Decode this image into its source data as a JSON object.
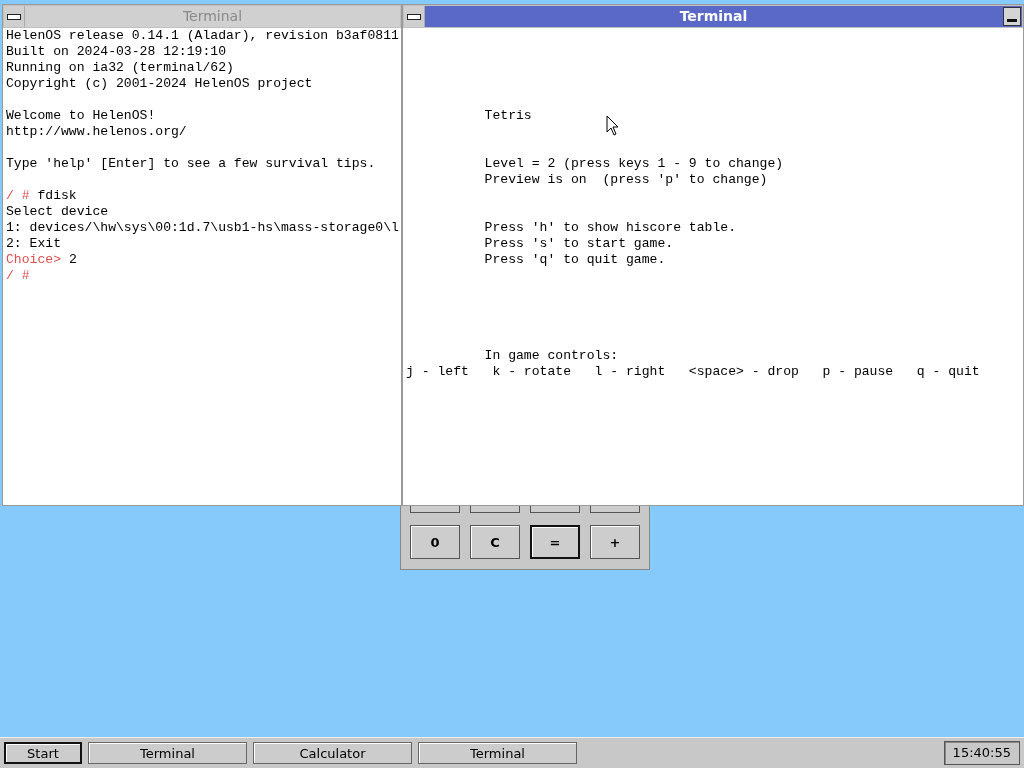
{
  "windows": [
    {
      "title": "Terminal",
      "active": false,
      "lines": [
        {
          "kind": "text",
          "segments": [
            {
              "text": "HelenOS release 0.14.1 (Aladar), revision b3af0811",
              "kind": "plain"
            }
          ]
        },
        {
          "kind": "text",
          "segments": [
            {
              "text": "Built on 2024-03-28 12:19:10",
              "kind": "plain"
            }
          ]
        },
        {
          "kind": "text",
          "segments": [
            {
              "text": "Running on ia32 (terminal/62)",
              "kind": "plain"
            }
          ]
        },
        {
          "kind": "text",
          "segments": [
            {
              "text": "Copyright (c) 2001-2024 HelenOS project",
              "kind": "plain"
            }
          ]
        },
        {
          "kind": "blank"
        },
        {
          "kind": "text",
          "segments": [
            {
              "text": "Welcome to HelenOS!",
              "kind": "plain"
            }
          ]
        },
        {
          "kind": "text",
          "segments": [
            {
              "text": "http://www.helenos.org/",
              "kind": "plain"
            }
          ]
        },
        {
          "kind": "blank"
        },
        {
          "kind": "text",
          "segments": [
            {
              "text": "Type 'help' [Enter] to see a few survival tips.",
              "kind": "plain"
            }
          ]
        },
        {
          "kind": "blank"
        },
        {
          "kind": "text",
          "segments": [
            {
              "text": "/ # ",
              "kind": "prompt"
            },
            {
              "text": "fdisk",
              "kind": "plain"
            }
          ]
        },
        {
          "kind": "text",
          "segments": [
            {
              "text": "Select device",
              "kind": "plain"
            }
          ]
        },
        {
          "kind": "text",
          "segments": [
            {
              "text": "1: devices/\\hw\\sys\\00:1d.7\\usb1-hs\\mass-storage0\\l",
              "kind": "plain"
            }
          ]
        },
        {
          "kind": "text",
          "segments": [
            {
              "text": "2: Exit",
              "kind": "plain"
            }
          ]
        },
        {
          "kind": "text",
          "segments": [
            {
              "text": "Choice> ",
              "kind": "prompt"
            },
            {
              "text": "2",
              "kind": "plain"
            }
          ]
        },
        {
          "kind": "text",
          "segments": [
            {
              "text": "/ #",
              "kind": "prompt"
            }
          ]
        }
      ]
    },
    {
      "title": "Terminal",
      "active": true,
      "lines": [
        {
          "kind": "blank"
        },
        {
          "kind": "blank"
        },
        {
          "kind": "blank"
        },
        {
          "kind": "blank"
        },
        {
          "kind": "blank"
        },
        {
          "kind": "text",
          "segments": [
            {
              "text": "          Tetris",
              "kind": "plain"
            }
          ]
        },
        {
          "kind": "blank"
        },
        {
          "kind": "blank"
        },
        {
          "kind": "text",
          "segments": [
            {
              "text": "          Level = 2 (press keys 1 - 9 to change)",
              "kind": "plain"
            }
          ]
        },
        {
          "kind": "text",
          "segments": [
            {
              "text": "          Preview is on  (press 'p' to change)",
              "kind": "plain"
            }
          ]
        },
        {
          "kind": "blank"
        },
        {
          "kind": "blank"
        },
        {
          "kind": "text",
          "segments": [
            {
              "text": "          Press 'h' to show hiscore table.",
              "kind": "plain"
            }
          ]
        },
        {
          "kind": "text",
          "segments": [
            {
              "text": "          Press 's' to start game.",
              "kind": "plain"
            }
          ]
        },
        {
          "kind": "text",
          "segments": [
            {
              "text": "          Press 'q' to quit game.",
              "kind": "plain"
            }
          ]
        },
        {
          "kind": "blank"
        },
        {
          "kind": "blank"
        },
        {
          "kind": "blank"
        },
        {
          "kind": "blank"
        },
        {
          "kind": "blank"
        },
        {
          "kind": "text",
          "segments": [
            {
              "text": "          In game controls:",
              "kind": "plain"
            }
          ]
        },
        {
          "kind": "text",
          "segments": [
            {
              "text": "j - left   k - rotate   l - right   <space> - drop   p - pause   q - quit",
              "kind": "plain"
            }
          ]
        }
      ]
    }
  ],
  "calculator": {
    "keys": [
      {
        "label": "0",
        "default": false
      },
      {
        "label": "C",
        "default": false
      },
      {
        "label": "=",
        "default": true
      },
      {
        "label": "+",
        "default": false
      }
    ]
  },
  "taskbar": {
    "start": {
      "label": "Start",
      "pressed": true
    },
    "tasks": [
      {
        "label": "Terminal"
      },
      {
        "label": "Calculator"
      },
      {
        "label": "Terminal"
      }
    ],
    "clock": "15:40:55"
  }
}
